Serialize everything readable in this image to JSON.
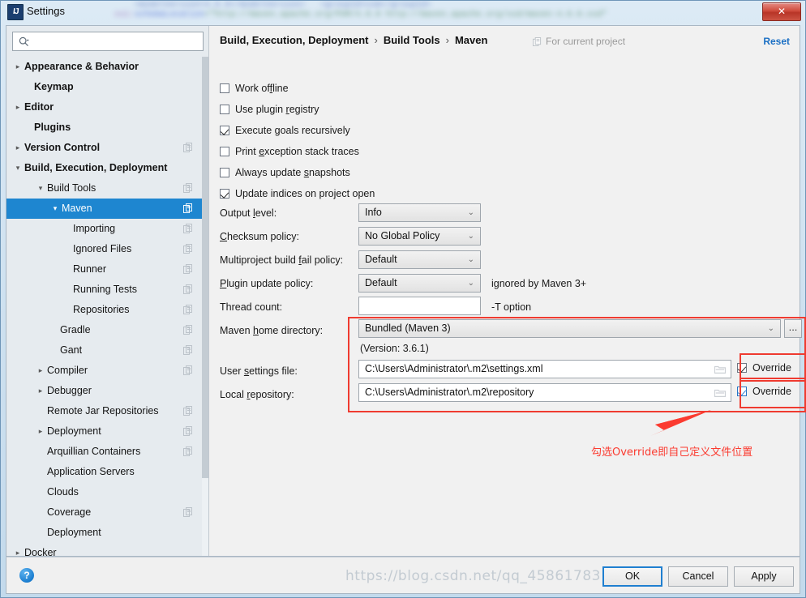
{
  "window": {
    "title": "Settings",
    "app_icon": "intellij-idea-icon",
    "close_label": "✕",
    "background_text": "xsi:schemaLocation=\"http://maven.apache.org/POM/4.0.0 http://maven.apache.org/xsd/maven-4.0.0.xsd\""
  },
  "search": {
    "value": "",
    "placeholder": ""
  },
  "sidebar": {
    "items": [
      {
        "label": "Appearance & Behavior",
        "indent": 22,
        "arrow": "▸",
        "bold": true,
        "copy": false,
        "selected": false
      },
      {
        "label": "Keymap",
        "indent": 34,
        "arrow": "",
        "bold": true,
        "copy": false,
        "selected": false
      },
      {
        "label": "Editor",
        "indent": 22,
        "arrow": "▸",
        "bold": true,
        "copy": false,
        "selected": false
      },
      {
        "label": "Plugins",
        "indent": 34,
        "arrow": "",
        "bold": true,
        "copy": false,
        "selected": false
      },
      {
        "label": "Version Control",
        "indent": 22,
        "arrow": "▸",
        "bold": true,
        "copy": true,
        "selected": false
      },
      {
        "label": "Build, Execution, Deployment",
        "indent": 22,
        "arrow": "▾",
        "bold": true,
        "copy": false,
        "selected": false
      },
      {
        "label": "Build Tools",
        "indent": 50,
        "arrow": "▾",
        "bold": false,
        "copy": true,
        "selected": false
      },
      {
        "label": "Maven",
        "indent": 68,
        "arrow": "▾",
        "bold": false,
        "copy": true,
        "selected": true
      },
      {
        "label": "Importing",
        "indent": 82,
        "arrow": "",
        "bold": false,
        "copy": true,
        "selected": false
      },
      {
        "label": "Ignored Files",
        "indent": 82,
        "arrow": "",
        "bold": false,
        "copy": true,
        "selected": false
      },
      {
        "label": "Runner",
        "indent": 82,
        "arrow": "",
        "bold": false,
        "copy": true,
        "selected": false
      },
      {
        "label": "Running Tests",
        "indent": 82,
        "arrow": "",
        "bold": false,
        "copy": true,
        "selected": false
      },
      {
        "label": "Repositories",
        "indent": 82,
        "arrow": "",
        "bold": false,
        "copy": true,
        "selected": false
      },
      {
        "label": "Gradle",
        "indent": 66,
        "arrow": "",
        "bold": false,
        "copy": true,
        "selected": false
      },
      {
        "label": "Gant",
        "indent": 66,
        "arrow": "",
        "bold": false,
        "copy": true,
        "selected": false
      },
      {
        "label": "Compiler",
        "indent": 50,
        "arrow": "▸",
        "bold": false,
        "copy": true,
        "selected": false
      },
      {
        "label": "Debugger",
        "indent": 50,
        "arrow": "▸",
        "bold": false,
        "copy": false,
        "selected": false
      },
      {
        "label": "Remote Jar Repositories",
        "indent": 50,
        "arrow": "",
        "bold": false,
        "copy": true,
        "selected": false
      },
      {
        "label": "Deployment",
        "indent": 50,
        "arrow": "▸",
        "bold": false,
        "copy": true,
        "selected": false
      },
      {
        "label": "Arquillian Containers",
        "indent": 50,
        "arrow": "",
        "bold": false,
        "copy": true,
        "selected": false
      },
      {
        "label": "Application Servers",
        "indent": 50,
        "arrow": "",
        "bold": false,
        "copy": false,
        "selected": false
      },
      {
        "label": "Clouds",
        "indent": 50,
        "arrow": "",
        "bold": false,
        "copy": false,
        "selected": false
      },
      {
        "label": "Coverage",
        "indent": 50,
        "arrow": "",
        "bold": false,
        "copy": true,
        "selected": false
      },
      {
        "label": "Deployment",
        "indent": 50,
        "arrow": "",
        "bold": false,
        "copy": false,
        "selected": false
      },
      {
        "label": "Docker",
        "indent": 22,
        "arrow": "▸",
        "bold": false,
        "copy": false,
        "selected": false
      }
    ]
  },
  "header": {
    "crumb1": "Build, Execution, Deployment",
    "crumb2": "Build Tools",
    "crumb3": "Maven",
    "separator": "›",
    "for_current_project": "For current project",
    "reset": "Reset"
  },
  "checkboxes": [
    {
      "label": "Work offline",
      "checked": false,
      "mnemonic_index": 7
    },
    {
      "label": "Use plugin registry",
      "checked": false,
      "mnemonic_index": 11
    },
    {
      "label": "Execute goals recursively",
      "checked": true,
      "mnemonic_index": 8
    },
    {
      "label": "Print exception stack traces",
      "checked": false,
      "mnemonic_index": 6
    },
    {
      "label": "Always update snapshots",
      "checked": false,
      "mnemonic_index": 14
    },
    {
      "label": "Update indices on project open",
      "checked": true,
      "mnemonic_index": -1
    }
  ],
  "fields": {
    "output_level": {
      "label": "Output level:",
      "value": "Info"
    },
    "checksum": {
      "label": "Checksum policy:",
      "value": "No Global Policy"
    },
    "multiproject": {
      "label": "Multiproject build fail policy:",
      "value": "Default"
    },
    "plugin_update": {
      "label": "Plugin update policy:",
      "value": "Default",
      "hint": "ignored by Maven 3+"
    },
    "thread_count": {
      "label": "Thread count:",
      "value": "",
      "hint": "-T option"
    },
    "maven_home": {
      "label": "Maven home directory:",
      "value": "Bundled (Maven 3)",
      "browse": "...",
      "version": "(Version: 3.6.1)"
    },
    "user_settings": {
      "label": "User settings file:",
      "value": "C:\\Users\\Administrator\\.m2\\settings.xml",
      "override_label": "Override",
      "override_checked": true
    },
    "local_repo": {
      "label": "Local repository:",
      "value": "C:\\Users\\Administrator\\.m2\\repository",
      "override_label": "Override",
      "override_checked": true
    }
  },
  "annotation": {
    "text": "勾选Override即自己定义文件位置",
    "color": "#fb3b30"
  },
  "footer": {
    "help": "?",
    "ok": "OK",
    "cancel": "Cancel",
    "apply": "Apply"
  },
  "watermark": "https://blog.csdn.net/qq_45861783"
}
